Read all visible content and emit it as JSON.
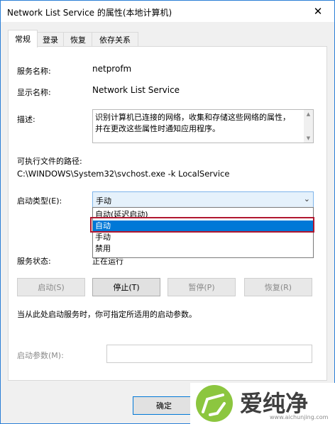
{
  "window": {
    "title": "Network List Service 的属性(本地计算机)"
  },
  "tabs": [
    {
      "label": "常规",
      "active": true
    },
    {
      "label": "登录"
    },
    {
      "label": "恢复"
    },
    {
      "label": "依存关系"
    }
  ],
  "general": {
    "service_name_label": "服务名称:",
    "service_name_value": "netprofm",
    "display_name_label": "显示名称:",
    "display_name_value": "Network List Service",
    "description_label": "描述:",
    "description_value": "识别计算机已连接的网络，收集和存储这些网络的属性，并在更改这些属性时通知应用程序。",
    "exe_path_label": "可执行文件的路径:",
    "exe_path_value": "C:\\WINDOWS\\System32\\svchost.exe -k LocalService",
    "startup_type_label": "启动类型(E):",
    "startup_type_value": "手动",
    "startup_options": [
      "自动(延迟启动)",
      "自动",
      "手动",
      "禁用"
    ],
    "startup_highlighted": "自动",
    "status_label": "服务状态:",
    "status_value": "正在运行",
    "buttons": {
      "start": "启动(S)",
      "stop": "停止(T)",
      "pause": "暂停(P)",
      "resume": "恢复(R)"
    },
    "hint": "当从此处启动服务时，你可指定所适用的启动参数。",
    "start_params_label": "启动参数(M):"
  },
  "footer": {
    "ok_label": "确定"
  },
  "watermark": {
    "text": "爱纯净",
    "url": "www.aichunjing.com"
  },
  "colors": {
    "accent": "#0078d7",
    "highlight_border": "#b0172f",
    "logo_green": "#8cc63f"
  },
  "icons": {
    "close": "close-icon",
    "dropdown": "chevron-down-icon",
    "logo": "aichunjing-logo-icon"
  }
}
